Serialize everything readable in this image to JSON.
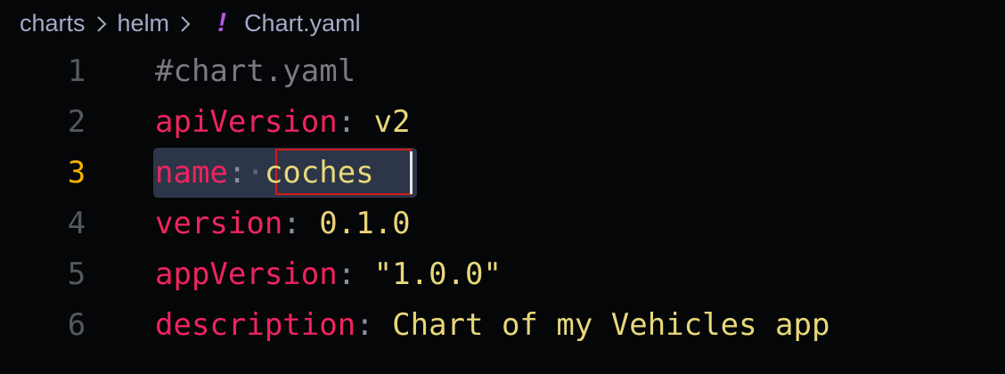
{
  "breadcrumb": {
    "items": [
      "charts",
      "helm",
      "Chart.yaml"
    ],
    "file_icon": "yaml-exclamation-icon",
    "file_icon_glyph": "!"
  },
  "editor": {
    "active_line": 3,
    "lines": [
      {
        "number": "1",
        "comment": "#chart.yaml"
      },
      {
        "number": "2",
        "key": "apiVersion",
        "colon": ":",
        "value": "v2"
      },
      {
        "number": "3",
        "key": "name",
        "colon": ":",
        "space_marker": "·",
        "value": "coches"
      },
      {
        "number": "4",
        "key": "version",
        "colon": ":",
        "value": "0.1.0"
      },
      {
        "number": "5",
        "key": "appVersion",
        "colon": ":",
        "value": "\"1.0.0\""
      },
      {
        "number": "6",
        "key": "description",
        "colon": ":",
        "value": "Chart of my Vehicles app"
      }
    ]
  },
  "colors": {
    "background": "#050608",
    "key": "#f0245e",
    "value": "#e8d87a",
    "comment": "#7a7a82",
    "line_number": "#55585e",
    "active_line_number": "#f2b400",
    "selection_border": "#d11a1a",
    "line_highlight": "#2c3648",
    "file_icon": "#b05ae0"
  }
}
